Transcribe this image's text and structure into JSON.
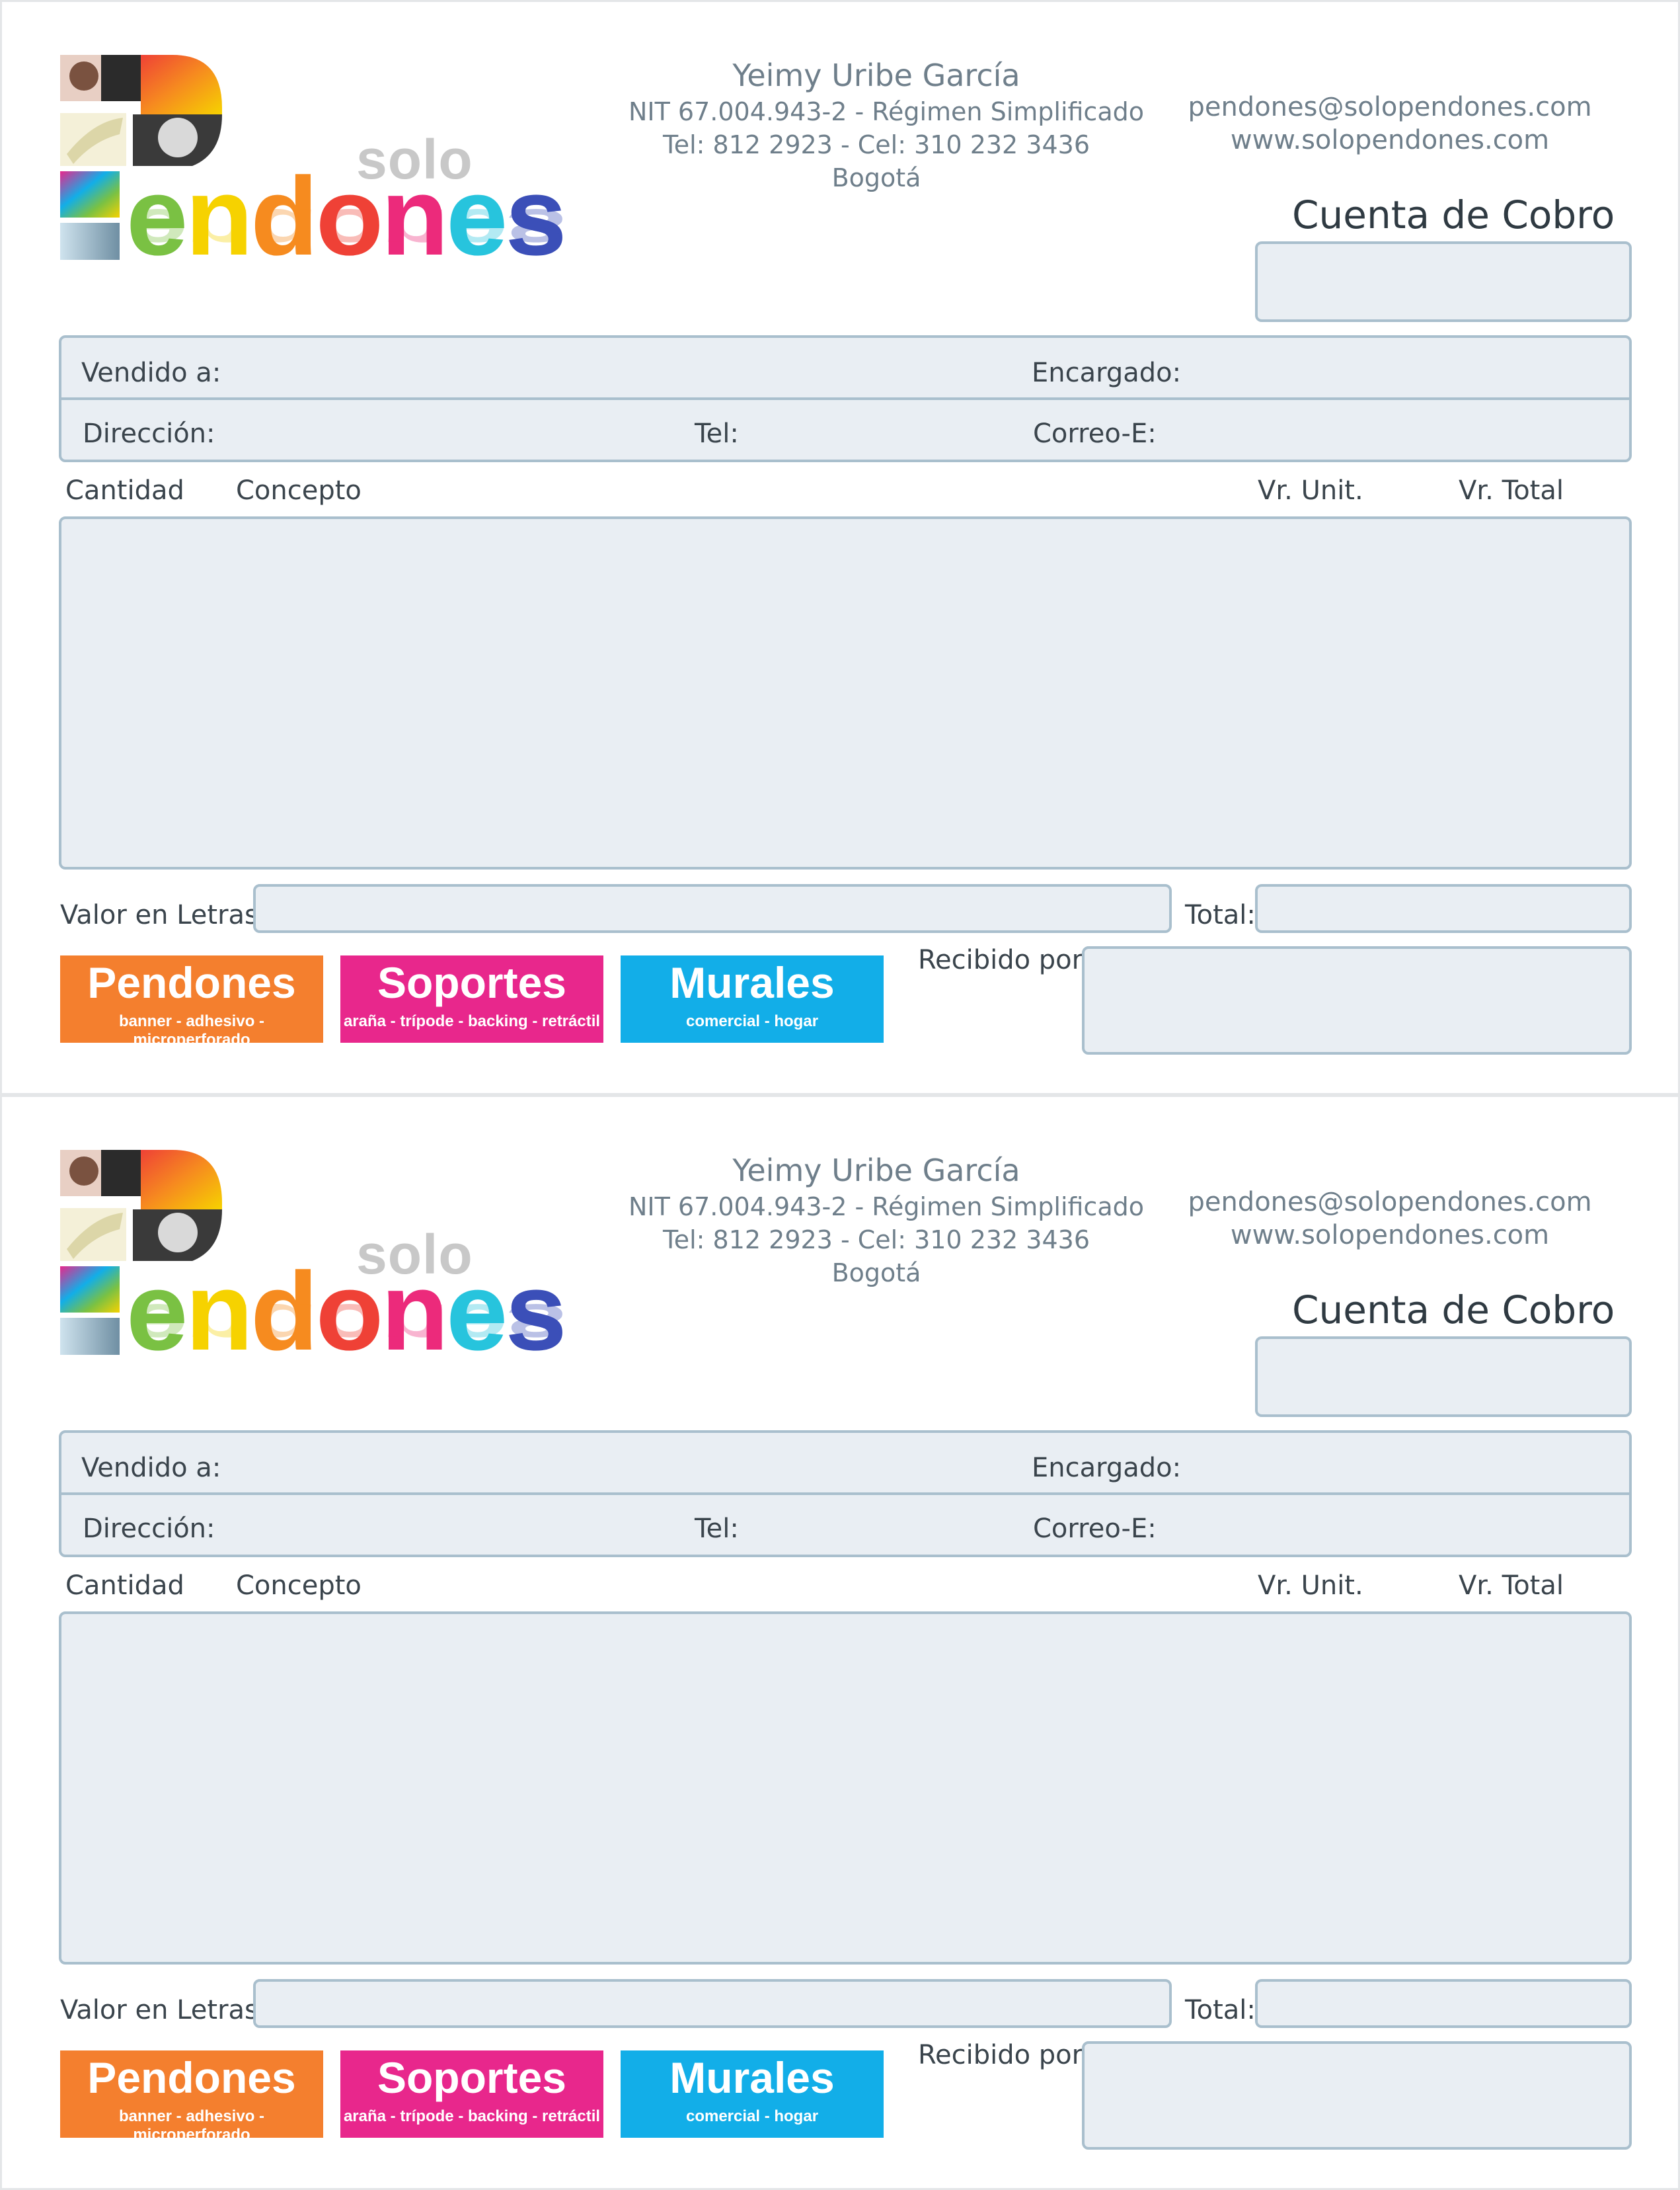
{
  "company": {
    "name": "Yeimy Uribe García",
    "nit": "NIT 67.004.943-2 - Régimen Simplificado",
    "phones": "Tel: 812 2923 - Cel: 310 232 3436",
    "city": "Bogotá",
    "email": "pendones@solopendones.com",
    "website": "www.solopendones.com"
  },
  "logo": {
    "solo": "solo",
    "letters": [
      "e",
      "n",
      "d",
      "o",
      "n",
      "e",
      "s"
    ],
    "colors": [
      "#7ac143",
      "#f6d200",
      "#f68b1f",
      "#ef4136",
      "#ec2a7b",
      "#27c4dd",
      "#3b4fb8"
    ]
  },
  "form": {
    "title": "Cuenta de Cobro",
    "sold_to": "Vendido a:",
    "in_charge": "Encargado:",
    "address": "Dirección:",
    "tel": "Tel:",
    "email": "Correo-E:",
    "qty": "Cantidad",
    "concept": "Concepto",
    "unit_value": "Vr. Unit.",
    "total_value": "Vr. Total",
    "value_words": "Valor en Letras:",
    "total": "Total:",
    "received_by": "Recibido por:"
  },
  "brands": [
    {
      "title": "Pendones",
      "subtitle": "banner - adhesivo - microperforado",
      "color": "#f47f2e"
    },
    {
      "title": "Soportes",
      "subtitle": "araña - trípode - backing - retráctil",
      "color": "#e8278c"
    },
    {
      "title": "Murales",
      "subtitle": "comercial - hogar",
      "color": "#12aee8"
    }
  ]
}
